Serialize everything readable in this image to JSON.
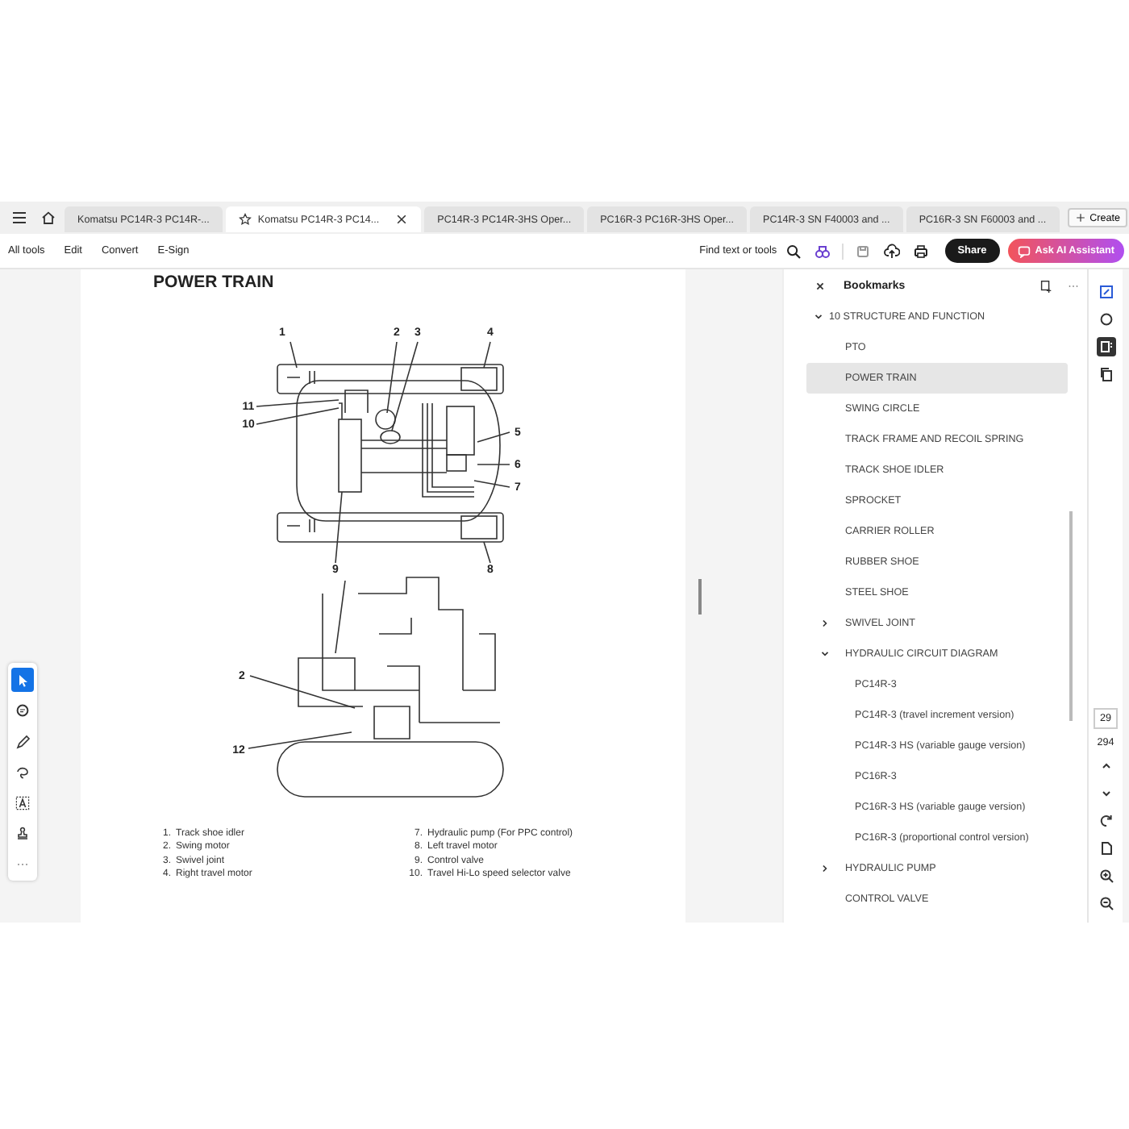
{
  "tabs": [
    {
      "label": "Komatsu PC14R-3 PC14R-...",
      "selected": false
    },
    {
      "label": "Komatsu PC14R-3 PC14...",
      "selected": true
    },
    {
      "label": "PC14R-3 PC14R-3HS Oper...",
      "selected": false
    },
    {
      "label": "PC16R-3 PC16R-3HS Oper...",
      "selected": false
    },
    {
      "label": "PC14R-3 SN F40003 and ...",
      "selected": false
    },
    {
      "label": "PC16R-3 SN F60003 and ...",
      "selected": false
    }
  ],
  "create_button": "Create",
  "toolbar": {
    "menu": [
      "All tools",
      "Edit",
      "Convert",
      "E-Sign"
    ],
    "find": "Find text or tools",
    "share": "Share",
    "ai_assistant": "Ask AI Assistant"
  },
  "document": {
    "title": "POWER TRAIN",
    "diagram_labels": [
      "1",
      "2",
      "3",
      "4",
      "11",
      "10",
      "5",
      "6",
      "7",
      "9",
      "8",
      "2",
      "12"
    ],
    "legend": [
      {
        "number": "1.",
        "text": "Track shoe idler"
      },
      {
        "number": "2.",
        "text": "Swing motor"
      },
      {
        "number": "3.",
        "text": "Swivel joint"
      },
      {
        "number": "4.",
        "text": "Right travel motor"
      },
      {
        "number": "7.",
        "text": "Hydraulic pump (For PPC control)"
      },
      {
        "number": "8.",
        "text": "Left travel motor"
      },
      {
        "number": "9.",
        "text": "Control valve"
      },
      {
        "number": "10.",
        "text": "Travel Hi-Lo speed selector valve"
      }
    ]
  },
  "tool_palette": [
    {
      "kind": "select",
      "selected": true
    },
    {
      "kind": "comment",
      "selected": false
    },
    {
      "kind": "pen",
      "selected": false
    },
    {
      "kind": "lasso",
      "selected": false
    },
    {
      "kind": "text",
      "selected": false
    },
    {
      "kind": "stamp",
      "selected": false
    },
    {
      "kind": "more",
      "selected": false
    }
  ],
  "bookmarks": {
    "title": "Bookmarks",
    "items": [
      {
        "label": "10 STRUCTURE AND FUNCTION",
        "expanded": true,
        "selected": false,
        "children": [
          {
            "label": "PTO",
            "selected": false
          },
          {
            "label": "POWER TRAIN",
            "selected": true
          },
          {
            "label": "SWING CIRCLE",
            "selected": false
          },
          {
            "label": "TRACK FRAME AND RECOIL SPRING",
            "selected": false
          },
          {
            "label": "TRACK SHOE IDLER",
            "selected": false
          },
          {
            "label": "SPROCKET",
            "selected": false
          },
          {
            "label": "CARRIER ROLLER",
            "selected": false
          },
          {
            "label": "RUBBER SHOE",
            "selected": false
          },
          {
            "label": "STEEL SHOE",
            "selected": false
          },
          {
            "label": "SWIVEL JOINT",
            "expanded": false,
            "selected": false
          },
          {
            "label": "HYDRAULIC CIRCUIT DIAGRAM",
            "expanded": true,
            "selected": false,
            "children": [
              {
                "label": "PC14R-3",
                "selected": false
              },
              {
                "label": "PC14R-3 (travel increment version)",
                "selected": false
              },
              {
                "label": "PC14R-3 HS (variable gauge version)",
                "selected": false
              },
              {
                "label": "PC16R-3",
                "selected": false
              },
              {
                "label": "PC16R-3 HS (variable gauge version)",
                "selected": false
              },
              {
                "label": "PC16R-3 (proportional control version)",
                "selected": false
              }
            ]
          },
          {
            "label": "HYDRAULIC PUMP",
            "expanded": false,
            "selected": false
          },
          {
            "label": "CONTROL VALVE",
            "selected": false
          }
        ]
      }
    ]
  },
  "page_nav": {
    "current": "29",
    "total": "294"
  }
}
